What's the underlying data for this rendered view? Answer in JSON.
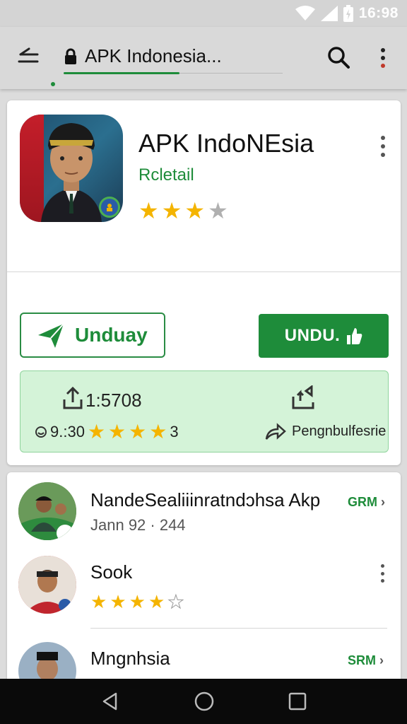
{
  "status_bar": {
    "time": "16:98"
  },
  "toolbar": {
    "title": "APK Indonesia...",
    "back_icon": "back-arrow-icon",
    "lock_icon": "lock-icon",
    "search_icon": "search-icon",
    "menu_icon": "more-vert-icon"
  },
  "app": {
    "title": "APK IndoNEsia",
    "subtitle": "Rcletail",
    "rating_stars": 3,
    "rating_max": 4,
    "btn_outline_label": "Unduay",
    "btn_solid_label": "UNDU.",
    "downloads": "1:5708",
    "rating_text_prefix": "9.:30",
    "rating_text_suffix": "3",
    "rating_row_stars": 4,
    "publisher": "Pengnbulfesrie"
  },
  "list": {
    "items": [
      {
        "title": "NandeSealiiinratndↄhsa Akp",
        "sub": "Jann 92 · 244",
        "action": "GRM",
        "stars": null
      },
      {
        "title": "Sook",
        "sub": "",
        "action": "",
        "stars": 4
      },
      {
        "title": "Mngnhsia",
        "sub": "",
        "action": "SRM",
        "stars": null
      }
    ]
  },
  "colors": {
    "accent": "#1e8c3a",
    "star": "#f4b400",
    "info_bg": "#d4f3d8"
  }
}
